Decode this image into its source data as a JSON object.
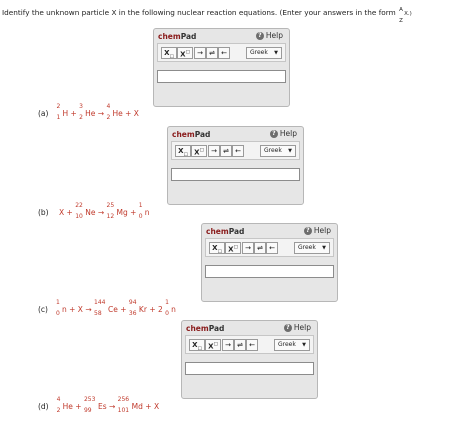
{
  "instructions": {
    "text": "Identify the unknown particle X in the following nuclear reaction equations. (Enter your answers in the form",
    "form_mass": "A",
    "form_symbol": "X.)",
    "form_atomic": "Z"
  },
  "chempad": {
    "title_chem": "chem",
    "title_pad": "Pad",
    "help_label": "Help",
    "btn_sub": "X",
    "btn_sub_mark": "□",
    "btn_sup": "X",
    "btn_sup_mark": "□",
    "btn_arrow": "→",
    "btn_eq": "⇌",
    "btn_back": "←",
    "greek_label": "Greek",
    "input_value": ""
  },
  "equations": [
    {
      "label": "(a)",
      "terms": [
        {
          "mass": "2",
          "atomic": "1",
          "sym": "H"
        },
        {
          "op": "+"
        },
        {
          "mass": "3",
          "atomic": "2",
          "sym": "He"
        },
        {
          "op": "→"
        },
        {
          "mass": "4",
          "atomic": "2",
          "sym": "He"
        },
        {
          "op": "+ X"
        }
      ]
    },
    {
      "label": "(b)",
      "terms": [
        {
          "op": "X +"
        },
        {
          "mass": "22",
          "atomic": "10",
          "sym": "Ne"
        },
        {
          "op": "→"
        },
        {
          "mass": "25",
          "atomic": "12",
          "sym": "Mg"
        },
        {
          "op": "+"
        },
        {
          "mass": "1",
          "atomic": "0",
          "sym": "n"
        }
      ]
    },
    {
      "label": "(c)",
      "terms": [
        {
          "mass": "1",
          "atomic": "0",
          "sym": "n"
        },
        {
          "op": "+ X →"
        },
        {
          "mass": "144",
          "atomic": "58",
          "sym": "Ce"
        },
        {
          "op": "+"
        },
        {
          "mass": "94",
          "atomic": "36",
          "sym": "Kr"
        },
        {
          "op": "+ 2"
        },
        {
          "mass": "1",
          "atomic": "0",
          "sym": "n"
        }
      ]
    },
    {
      "label": "(d)",
      "terms": [
        {
          "mass": "4",
          "atomic": "2",
          "sym": "He"
        },
        {
          "op": "+"
        },
        {
          "mass": "253",
          "atomic": "99",
          "sym": "Es"
        },
        {
          "op": "→"
        },
        {
          "mass": "256",
          "atomic": "101",
          "sym": "Md"
        },
        {
          "op": "+ X"
        }
      ]
    }
  ]
}
